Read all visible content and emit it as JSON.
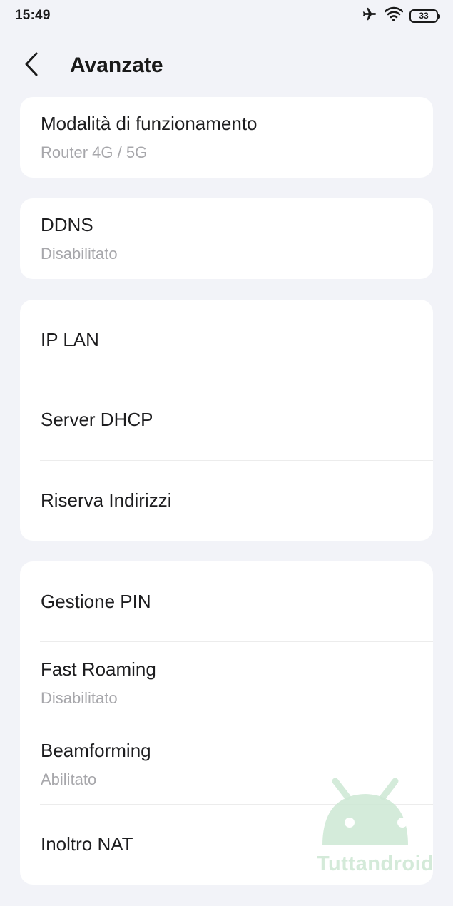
{
  "status_bar": {
    "time": "15:49",
    "battery_level": "33",
    "icons": [
      "airplane-icon",
      "wifi-icon",
      "battery-icon"
    ]
  },
  "header": {
    "title": "Avanzate",
    "back_icon": "chevron-left-icon"
  },
  "cards": [
    {
      "items": [
        {
          "label": "Modalità di funzionamento",
          "value": "Router 4G / 5G"
        }
      ]
    },
    {
      "items": [
        {
          "label": "DDNS",
          "value": "Disabilitato"
        }
      ]
    },
    {
      "items": [
        {
          "label": "IP LAN"
        },
        {
          "label": "Server DHCP"
        },
        {
          "label": "Riserva Indirizzi"
        }
      ]
    },
    {
      "items": [
        {
          "label": "Gestione PIN"
        },
        {
          "label": "Fast Roaming",
          "value": "Disabilitato"
        },
        {
          "label": "Beamforming",
          "value": "Abilitato"
        },
        {
          "label": "Inoltro NAT"
        }
      ]
    }
  ],
  "watermark": {
    "text": "Tuttandroid",
    "logo_icon": "android-robot-icon"
  },
  "colors": {
    "background": "#f2f3f8",
    "card": "#ffffff",
    "primary_text": "#1d1d1f",
    "secondary_text": "#a7a7ab",
    "watermark": "#cde6d2"
  }
}
